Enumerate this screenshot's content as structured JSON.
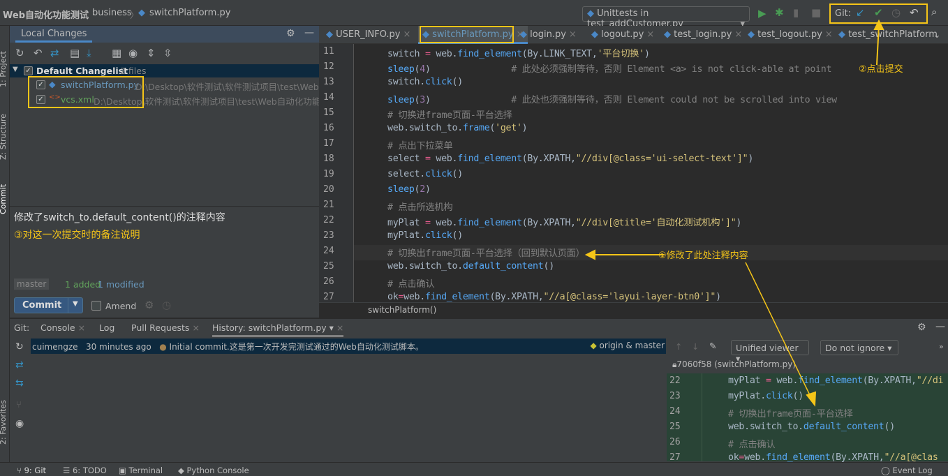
{
  "breadcrumb": [
    "Web自动化功能测试",
    "business",
    "switchPlatform.py"
  ],
  "run_config": "Unittests in test_addCustomer.py",
  "git_label": "Git:",
  "left_stripe": [
    "1: Project",
    "Z: Structure",
    "Commit",
    "2: Favorites"
  ],
  "local_changes": {
    "tab": "Local Changes",
    "changelist": "Default Changelist",
    "count": "2 files",
    "files": [
      {
        "name": "switchPlatform.py",
        "path": "D:\\Desktop\\软件测试\\软件测试项目\\test\\Web自动化功能测试",
        "color": "#6897bb"
      },
      {
        "name": "vcs.xml",
        "path": "D:\\Desktop\\软件测试\\软件测试项目\\test\\Web自动化功能测试",
        "color": "#62a35c"
      }
    ]
  },
  "commit": {
    "message": "修改了switch_to.default_content()的注释内容",
    "branch": "master",
    "added": "1 added",
    "modified": "1 modified",
    "button": "Commit",
    "amend": "Amend"
  },
  "tabs": [
    "USER_INFO.py",
    "switchPlatform.py",
    "login.py",
    "logout.py",
    "test_login.py",
    "test_logout.py",
    "test_switchPlatform"
  ],
  "active_tab": 1,
  "code": [
    {
      "n": "11",
      "t": [
        [
          "",
          "switch "
        ],
        [
          "eq",
          "="
        ],
        [
          "",
          " web."
        ],
        [
          "fn",
          "find_element"
        ],
        [
          "",
          "(By.LINK_TEXT,"
        ],
        [
          "str",
          "'平台切换'"
        ],
        [
          "",
          ")"
        ]
      ]
    },
    {
      "n": "12",
      "t": [
        [
          "fn",
          "sleep"
        ],
        [
          "",
          "("
        ],
        [
          "num",
          "4"
        ],
        [
          "",
          ")               "
        ],
        [
          "cm",
          "# 此处必须强制等待，否则 Element <a> is not click-able at point"
        ]
      ]
    },
    {
      "n": "13",
      "t": [
        [
          "",
          "switch."
        ],
        [
          "fn",
          "click"
        ],
        [
          "",
          "()"
        ]
      ]
    },
    {
      "n": "14",
      "t": [
        [
          "fn",
          "sleep"
        ],
        [
          "",
          "("
        ],
        [
          "num",
          "3"
        ],
        [
          "",
          ")               "
        ],
        [
          "cm",
          "# 此处也须强制等待，否则 Element could not be scrolled into view"
        ]
      ]
    },
    {
      "n": "15",
      "t": [
        [
          "cm",
          "# 切换进frame页面-平台选择"
        ]
      ]
    },
    {
      "n": "16",
      "t": [
        [
          "",
          "web.switch_to."
        ],
        [
          "fn",
          "frame"
        ],
        [
          "",
          "("
        ],
        [
          "str",
          "'get'"
        ],
        [
          "",
          ")"
        ]
      ]
    },
    {
      "n": "17",
      "t": [
        [
          "cm",
          "# 点出下拉菜单"
        ]
      ]
    },
    {
      "n": "18",
      "t": [
        [
          "",
          "select "
        ],
        [
          "eq",
          "="
        ],
        [
          "",
          " web."
        ],
        [
          "fn",
          "find_element"
        ],
        [
          "",
          "(By.XPATH,"
        ],
        [
          "str",
          "\"//div[@class='ui-select-text']\""
        ],
        [
          "",
          ")"
        ]
      ]
    },
    {
      "n": "19",
      "t": [
        [
          "",
          "select."
        ],
        [
          "fn",
          "click"
        ],
        [
          "",
          "()"
        ]
      ]
    },
    {
      "n": "20",
      "t": [
        [
          "fn",
          "sleep"
        ],
        [
          "",
          "("
        ],
        [
          "num",
          "2"
        ],
        [
          "",
          ")"
        ]
      ]
    },
    {
      "n": "21",
      "t": [
        [
          "cm",
          "# 点击所选机构"
        ]
      ]
    },
    {
      "n": "22",
      "t": [
        [
          "",
          "myPlat "
        ],
        [
          "eq",
          "="
        ],
        [
          "",
          " web."
        ],
        [
          "fn",
          "find_element"
        ],
        [
          "",
          "(By.XPATH,"
        ],
        [
          "str",
          "\"//div[@title='自动化测试机构']\""
        ],
        [
          "",
          ")"
        ]
      ]
    },
    {
      "n": "23",
      "t": [
        [
          "",
          "myPlat."
        ],
        [
          "fn",
          "click"
        ],
        [
          "",
          "()"
        ]
      ]
    },
    {
      "n": "24",
      "t": [
        [
          "cm",
          "# 切换出frame页面-平台选择（回到默认页面）"
        ]
      ]
    },
    {
      "n": "25",
      "t": [
        [
          "",
          "web.switch_to."
        ],
        [
          "fn",
          "default_content"
        ],
        [
          "",
          "()"
        ]
      ]
    },
    {
      "n": "26",
      "t": [
        [
          "cm",
          "# 点击确认"
        ]
      ]
    },
    {
      "n": "27",
      "t": [
        [
          "",
          "ok"
        ],
        [
          "eq",
          "="
        ],
        [
          "",
          "web."
        ],
        [
          "fn",
          "find_element"
        ],
        [
          "",
          "(By.XPATH,"
        ],
        [
          "str",
          "\"//a[@class='layui-layer-btn0']\""
        ],
        [
          "",
          ")"
        ]
      ]
    }
  ],
  "editor_breadcrumb": "switchPlatform()",
  "bottom_tabs": [
    "Git:",
    "Console",
    "Log",
    "Pull Requests",
    "History: switchPlatform.py"
  ],
  "log": {
    "author": "cuimengze",
    "time": "30 minutes ago",
    "message": "Initial commit.这是第一次开发完测试通过的Web自动化测试脚本。",
    "refs": "origin & master"
  },
  "diff": {
    "viewer": "Unified viewer",
    "ignore": "Do not ignore",
    "revision": "7060f58 (switchPlatform.py)",
    "code": [
      {
        "n": "22",
        "t": [
          [
            "",
            "myPlat "
          ],
          [
            "eq",
            "="
          ],
          [
            "",
            " web."
          ],
          [
            "fn",
            "find_element"
          ],
          [
            "",
            "(By.XPATH,"
          ],
          [
            "str",
            "\"//di"
          ]
        ]
      },
      {
        "n": "23",
        "t": [
          [
            "",
            "myPlat."
          ],
          [
            "fn",
            "click"
          ],
          [
            "",
            "()"
          ]
        ]
      },
      {
        "n": "24",
        "t": [
          [
            "cm",
            "# 切换出frame页面-平台选择"
          ]
        ]
      },
      {
        "n": "25",
        "t": [
          [
            "",
            "web.switch_to."
          ],
          [
            "fn",
            "default_content"
          ],
          [
            "",
            "()"
          ]
        ]
      },
      {
        "n": "26",
        "t": [
          [
            "cm",
            "# 点击确认"
          ]
        ]
      },
      {
        "n": "27",
        "t": [
          [
            "",
            "ok"
          ],
          [
            "eq",
            "="
          ],
          [
            "",
            "web."
          ],
          [
            "fn",
            "find_element"
          ],
          [
            "",
            "(By.XPATH,"
          ],
          [
            "str",
            "\"//a[@clas"
          ]
        ]
      }
    ]
  },
  "statusbar": [
    "9: Git",
    "6: TODO",
    "Terminal",
    "Python Console",
    "Event Log"
  ],
  "annotations": {
    "a1": "①修改了此处注释内容",
    "a2": "②点击提交",
    "a3": "③对这一次提交时的备注说明"
  },
  "colors": {
    "accent": "#4a88c7",
    "annotation": "#f5c518",
    "selection": "#0d293e",
    "diff_bg": "#294436"
  }
}
